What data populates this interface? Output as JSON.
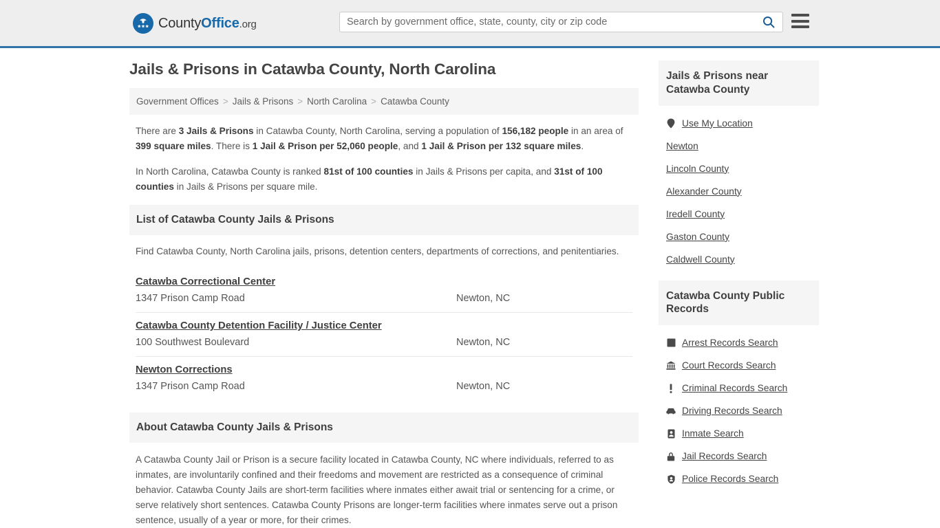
{
  "header": {
    "logo_name": "County",
    "logo_bold": "Office",
    "logo_suffix": ".org",
    "search_placeholder": "Search by government office, state, county, city or zip code",
    "search_value": "",
    "search_icon": "search-icon",
    "menu_icon": "hamburger-menu-icon",
    "accent_color": "#3174a8"
  },
  "page": {
    "title": "Jails & Prisons in Catawba County, North Carolina"
  },
  "breadcrumb": {
    "separator": ">",
    "items": [
      {
        "label": "Government Offices"
      },
      {
        "label": "Jails & Prisons"
      },
      {
        "label": "North Carolina"
      },
      {
        "label": "Catawba County"
      }
    ]
  },
  "intro": {
    "paragraph_1_parts": [
      {
        "text": "There are ",
        "bold": false
      },
      {
        "text": "3 Jails & Prisons",
        "bold": true
      },
      {
        "text": " in Catawba County, North Carolina, serving a population of ",
        "bold": false
      },
      {
        "text": "156,182 people",
        "bold": true
      },
      {
        "text": " in an area of ",
        "bold": false
      },
      {
        "text": "399 square miles",
        "bold": true
      },
      {
        "text": ". There is ",
        "bold": false
      },
      {
        "text": "1 Jail & Prison per 52,060 people",
        "bold": true
      },
      {
        "text": ", and ",
        "bold": false
      },
      {
        "text": "1 Jail & Prison per 132 square miles",
        "bold": true
      },
      {
        "text": ".",
        "bold": false
      }
    ],
    "paragraph_2_parts": [
      {
        "text": "In North Carolina, Catawba County is ranked ",
        "bold": false
      },
      {
        "text": "81st of 100 counties",
        "bold": true
      },
      {
        "text": " in Jails & Prisons per capita, and ",
        "bold": false
      },
      {
        "text": "31st of 100 counties",
        "bold": true
      },
      {
        "text": " in Jails & Prisons per square mile.",
        "bold": false
      }
    ]
  },
  "list_section": {
    "heading": "List of Catawba County Jails & Prisons",
    "description": "Find Catawba County, North Carolina jails, prisons, detention centers, departments of corrections, and penitentiaries.",
    "facilities": [
      {
        "name": "Catawba Correctional Center",
        "address": "1347 Prison Camp Road",
        "city_state": "Newton, NC"
      },
      {
        "name": "Catawba County Detention Facility / Justice Center",
        "address": "100 Southwest Boulevard",
        "city_state": "Newton, NC"
      },
      {
        "name": "Newton Corrections",
        "address": "1347 Prison Camp Road",
        "city_state": "Newton, NC"
      }
    ]
  },
  "about_section": {
    "heading": "About Catawba County Jails & Prisons",
    "body": "A Catawba County Jail or Prison is a secure facility located in Catawba County, NC where individuals, referred to as inmates, are involuntarily confined and their freedoms and movement are restricted as a consequence of criminal behavior. Catawba County Jails are short-term facilities where inmates either await trial or sentencing for a crime, or serve relatively short sentences. Catawba County Prisons are longer-term facilities where inmates serve out a prison sentence, usually of a year or more, for their crimes."
  },
  "sidebar": {
    "nearby": {
      "heading": "Jails & Prisons near Catawba County",
      "items": [
        {
          "label": "Use My Location",
          "icon": "map-pin-icon"
        },
        {
          "label": "Newton",
          "icon": ""
        },
        {
          "label": "Lincoln County",
          "icon": ""
        },
        {
          "label": "Alexander County",
          "icon": ""
        },
        {
          "label": "Iredell County",
          "icon": ""
        },
        {
          "label": "Gaston County",
          "icon": ""
        },
        {
          "label": "Caldwell County",
          "icon": ""
        }
      ]
    },
    "public_records": {
      "heading": "Catawba County Public Records",
      "items": [
        {
          "label": "Arrest Records Search",
          "icon": "fingerprint-card-icon"
        },
        {
          "label": "Court Records Search",
          "icon": "courthouse-icon"
        },
        {
          "label": "Criminal Records Search",
          "icon": "exclamation-icon"
        },
        {
          "label": "Driving Records Search",
          "icon": "car-icon"
        },
        {
          "label": "Inmate Search",
          "icon": "id-card-icon"
        },
        {
          "label": "Jail Records Search",
          "icon": "padlock-icon"
        },
        {
          "label": "Police Records Search",
          "icon": "police-badge-icon"
        }
      ]
    }
  }
}
